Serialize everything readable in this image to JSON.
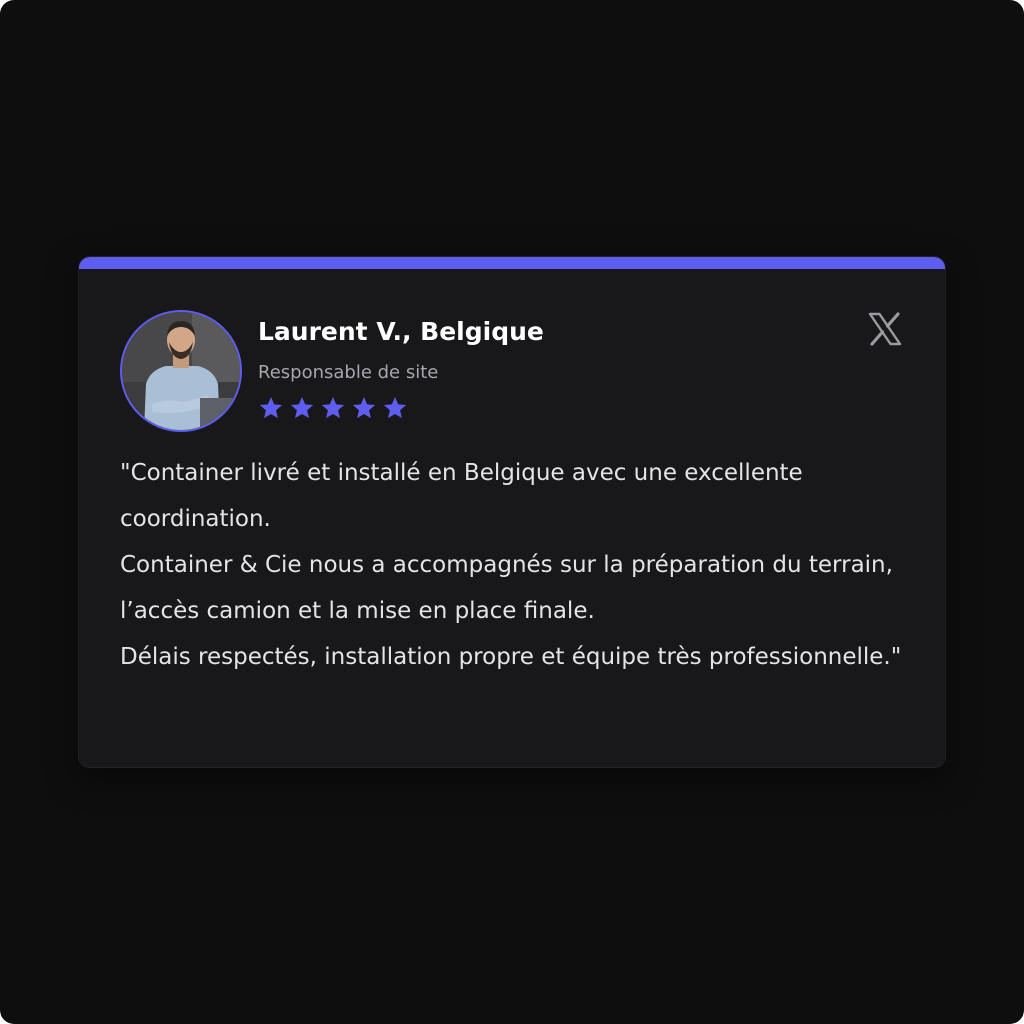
{
  "review": {
    "name": "Laurent V., Belgique",
    "role": "Responsable de site",
    "rating": 5,
    "rating_max": 5,
    "platform_icon": "x-logo-icon",
    "quote_lines": [
      "\"Container livré et installé en Belgique avec une excellente coordination.",
      "Container & Cie nous a accompagnés sur la préparation du terrain, l’accès camion et la mise en place finale.",
      "Délais respectés, installation propre et équipe très professionnelle.\""
    ]
  },
  "colors": {
    "accent": "#5f5cf0",
    "card_background": "#18181b",
    "page_background": "#0e0e0f",
    "text_primary": "#ffffff",
    "text_secondary": "#a6a6ad",
    "icon_gray": "#9a9aa0"
  }
}
